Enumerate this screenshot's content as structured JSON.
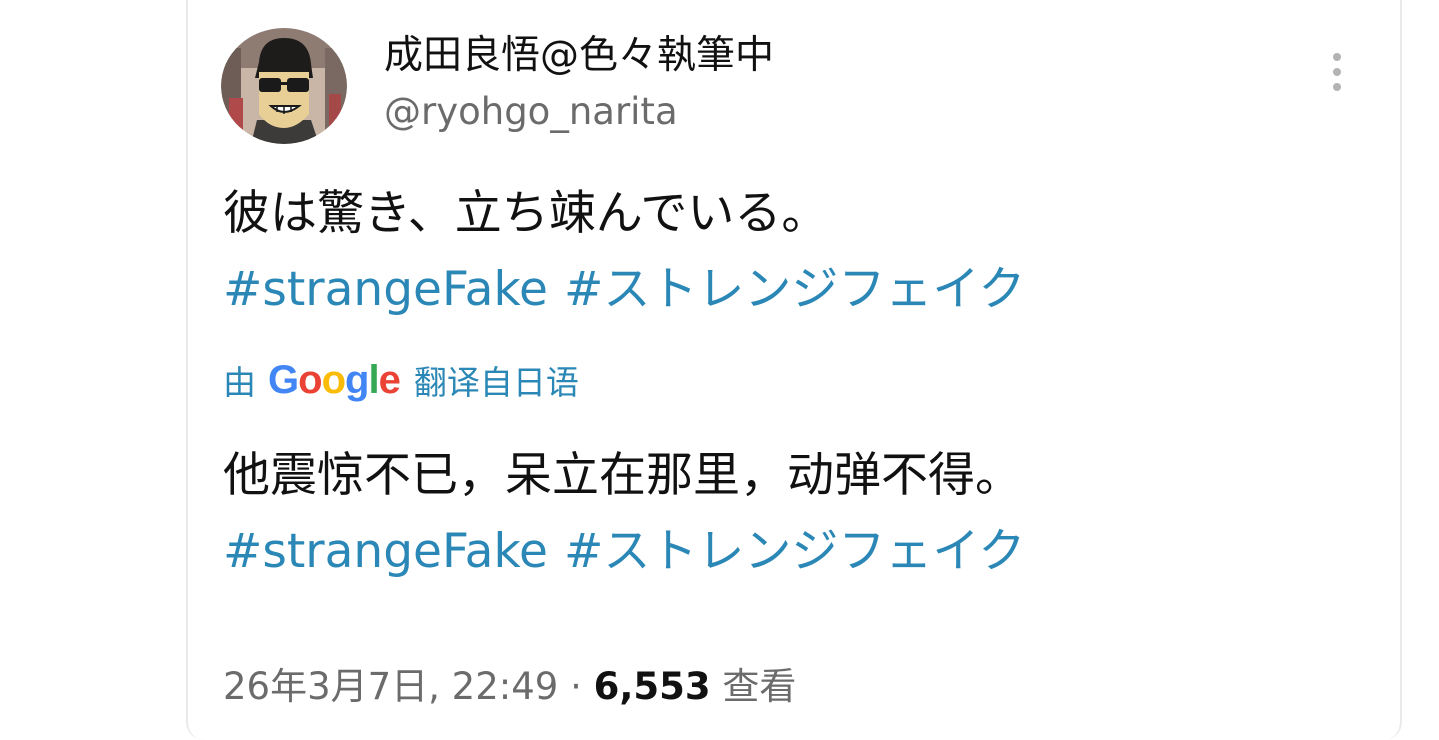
{
  "tweet": {
    "author": {
      "display_name": "成田良悟@色々執筆中",
      "handle": "@ryohgo_narita"
    },
    "original_text": "彼は驚き、立ち竦んでいる。",
    "hashtags": [
      "#strangeFake",
      "#ストレンジフェイク"
    ],
    "translation": {
      "prefix": "由",
      "provider": "Google",
      "provider_letters": [
        {
          "char": "G",
          "color": "#4285F4"
        },
        {
          "char": "o",
          "color": "#EA4335"
        },
        {
          "char": "o",
          "color": "#FBBC05"
        },
        {
          "char": "g",
          "color": "#4285F4"
        },
        {
          "char": "l",
          "color": "#34A853"
        },
        {
          "char": "e",
          "color": "#EA4335"
        }
      ],
      "suffix": "翻译自日语",
      "text": "他震惊不已，呆立在那里，动弹不得。"
    },
    "meta": {
      "timestamp": "26年3月7日, 22:49",
      "separator": "·",
      "views_count": "6,553",
      "views_label": "查看"
    },
    "icons": {
      "more": "more-vertical-icon",
      "avatar": "avatar"
    },
    "colors": {
      "hashtag": "#2a87b6",
      "text": "#111111",
      "muted": "#6b6b6b"
    }
  }
}
